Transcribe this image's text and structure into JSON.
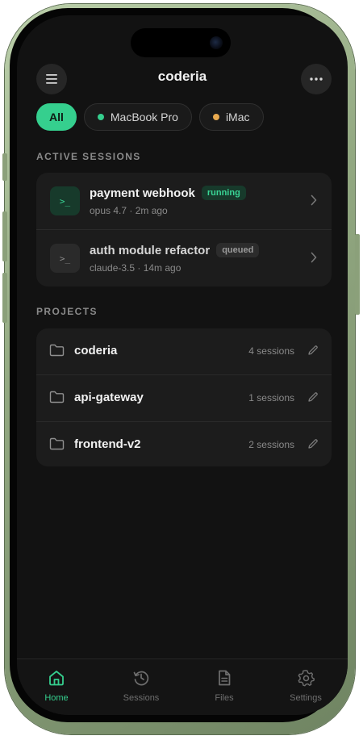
{
  "colors": {
    "accent": "#35cf8e",
    "background": "#121212",
    "card": "#1c1c1c",
    "macbook_dot": "#35cf8e",
    "imac_dot": "#e8a94f"
  },
  "header": {
    "title": "coderia",
    "menu_icon": "hamburger-icon",
    "more_icon": "ellipsis-icon"
  },
  "filters": [
    {
      "label": "All",
      "active": true
    },
    {
      "label": "MacBook Pro",
      "dot": "#35cf8e"
    },
    {
      "label": "iMac",
      "dot": "#e8a94f"
    }
  ],
  "active_sessions": {
    "label": "ACTIVE SESSIONS",
    "items": [
      {
        "title": "payment webhook",
        "status": "running",
        "meta": "opus 4.7 · 2m ago",
        "icon": "terminal-icon"
      },
      {
        "title": "auth module refactor",
        "status": "queued",
        "meta": "claude-3.5 · 14m ago",
        "icon": "terminal-icon"
      }
    ]
  },
  "projects": {
    "label": "PROJECTS",
    "items": [
      {
        "name": "coderia",
        "count": "4 sessions"
      },
      {
        "name": "api-gateway",
        "count": "1 sessions"
      },
      {
        "name": "frontend-v2",
        "count": "2 sessions"
      }
    ]
  },
  "tabs": [
    {
      "label": "Home",
      "icon": "home-icon",
      "active": true
    },
    {
      "label": "Sessions",
      "icon": "history-icon"
    },
    {
      "label": "Files",
      "icon": "file-icon"
    },
    {
      "label": "Settings",
      "icon": "gear-icon"
    }
  ]
}
